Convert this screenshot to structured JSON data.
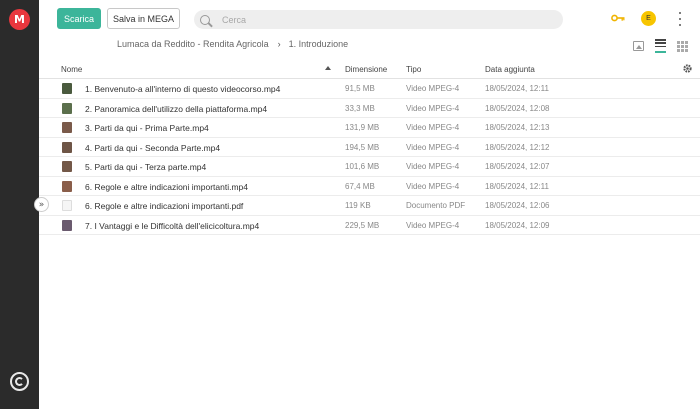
{
  "sidebar": {
    "logo": "M",
    "expand_glyph": "»"
  },
  "topbar": {
    "download_label": "Scarica",
    "save_label": "Salva in MEGA",
    "search_placeholder": "Cerca",
    "search_value": "",
    "avatar_initial": "E"
  },
  "breadcrumb": {
    "parent": "Lumaca da Reddito - Rendita Agricola",
    "separator": "›",
    "current": "1. Introduzione"
  },
  "table": {
    "columns": {
      "name": "Nome",
      "size": "Dimensione",
      "type": "Tipo",
      "date": "Data aggiunta"
    },
    "rows": [
      {
        "name": "1. Benvenuto-a all'interno di questo videocorso.mp4",
        "size": "91,5 MB",
        "type": "Video MPEG-4",
        "date": "18/05/2024, 12:11",
        "thumb_color": "#4a5a3e"
      },
      {
        "name": "2. Panoramica dell'utilizzo della piattaforma.mp4",
        "size": "33,3 MB",
        "type": "Video MPEG-4",
        "date": "18/05/2024, 12:08",
        "thumb_color": "#5b6f4c"
      },
      {
        "name": "3. Parti da qui - Prima Parte.mp4",
        "size": "131,9 MB",
        "type": "Video MPEG-4",
        "date": "18/05/2024, 12:13",
        "thumb_color": "#7a5a4a"
      },
      {
        "name": "4. Parti da qui - Seconda Parte.mp4",
        "size": "194,5 MB",
        "type": "Video MPEG-4",
        "date": "18/05/2024, 12:12",
        "thumb_color": "#6e5546"
      },
      {
        "name": "5. Parti da qui - Terza parte.mp4",
        "size": "101,6 MB",
        "type": "Video MPEG-4",
        "date": "18/05/2024, 12:07",
        "thumb_color": "#735848"
      },
      {
        "name": "6. Regole e altre indicazioni importanti.mp4",
        "size": "67,4 MB",
        "type": "Video MPEG-4",
        "date": "18/05/2024, 12:11",
        "thumb_color": "#8a5e4a"
      },
      {
        "name": "6. Regole e altre indicazioni importanti.pdf",
        "size": "119 KB",
        "type": "Documento PDF",
        "date": "18/05/2024, 12:06",
        "thumb_color": "#f5f5f5"
      },
      {
        "name": "7. I Vantaggi e le Difficoltà dell'elicicoltura.mp4",
        "size": "229,5 MB",
        "type": "Video MPEG-4",
        "date": "18/05/2024, 12:09",
        "thumb_color": "#6a5a6e"
      }
    ]
  },
  "icons": {
    "search": "search-icon",
    "key": "key-icon",
    "kebab": "kebab-menu-icon",
    "gear": "gear-icon",
    "sync": "sync-icon"
  },
  "colors": {
    "accent": "#3cb59a",
    "logo": "#e9373e",
    "avatar": "#f7c500",
    "key": "#f0b400"
  }
}
